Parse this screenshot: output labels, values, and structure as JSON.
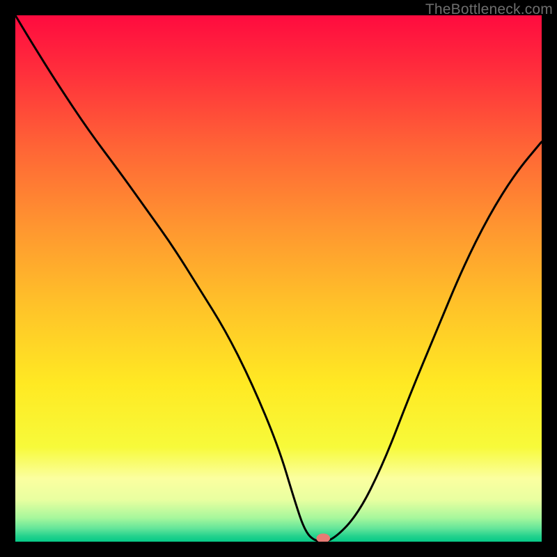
{
  "watermark": "TheBottleneck.com",
  "chart_data": {
    "type": "line",
    "title": "",
    "xlabel": "",
    "ylabel": "",
    "xlim": [
      0,
      100
    ],
    "ylim": [
      0,
      100
    ],
    "grid": false,
    "legend": false,
    "background": {
      "kind": "vertical_gradient",
      "stops": [
        {
          "pos": 0.0,
          "color": "#ff0b3f"
        },
        {
          "pos": 0.1,
          "color": "#ff2c3c"
        },
        {
          "pos": 0.25,
          "color": "#ff6436"
        },
        {
          "pos": 0.4,
          "color": "#ff9530"
        },
        {
          "pos": 0.55,
          "color": "#ffc229"
        },
        {
          "pos": 0.7,
          "color": "#ffe923"
        },
        {
          "pos": 0.82,
          "color": "#f7fa3a"
        },
        {
          "pos": 0.88,
          "color": "#fbffa0"
        },
        {
          "pos": 0.92,
          "color": "#e9ffa0"
        },
        {
          "pos": 0.955,
          "color": "#a6f79c"
        },
        {
          "pos": 0.975,
          "color": "#63e59a"
        },
        {
          "pos": 0.99,
          "color": "#22d18d"
        },
        {
          "pos": 1.0,
          "color": "#06c987"
        }
      ]
    },
    "series": [
      {
        "name": "curve",
        "stroke": "#000000",
        "x": [
          0,
          3,
          8,
          14,
          20,
          25,
          30,
          35,
          40,
          45,
          50,
          53,
          55,
          57,
          60,
          65,
          70,
          75,
          80,
          85,
          90,
          95,
          100
        ],
        "y": [
          100,
          95,
          87,
          78,
          70,
          63,
          56,
          48,
          40,
          30,
          18,
          8,
          2,
          0,
          0,
          5,
          15,
          28,
          40,
          52,
          62,
          70,
          76
        ]
      }
    ],
    "marker": {
      "x": 58.5,
      "y": 0,
      "rx": 1.3,
      "ry": 0.9,
      "fill": "#e77b74"
    }
  }
}
